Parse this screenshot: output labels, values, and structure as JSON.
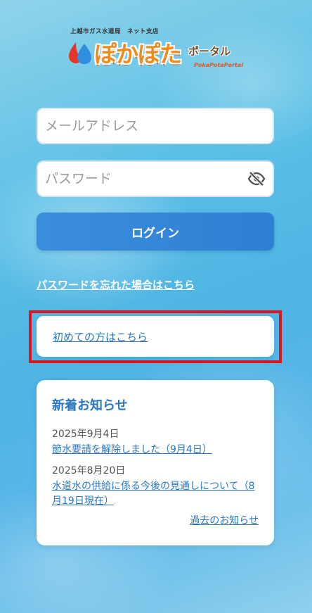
{
  "logo": {
    "top_text": "上越市ガス水道局　ネット支店",
    "main_text": "ぽかぽた",
    "sub_text": "ポータル",
    "english": "PokaPotaPortal"
  },
  "form": {
    "email_placeholder": "メールアドレス",
    "email_value": "",
    "password_placeholder": "パスワード",
    "password_value": "",
    "login_label": "ログイン"
  },
  "links": {
    "forgot_password": "パスワードを忘れた場合はこちら",
    "first_time": "初めての方はこちら"
  },
  "news": {
    "title": "新着お知らせ",
    "items": [
      {
        "date": "2025年9月4日",
        "text": "節水要請を解除しました（9月4日）"
      },
      {
        "date": "2025年8月20日",
        "text": "水道水の供給に係る今後の見通しについて（8月19日現在）"
      }
    ],
    "more_label": "過去のお知らせ"
  },
  "colors": {
    "accent": "#2f7fd4",
    "link": "#2a77c0",
    "highlight": "#d9171d"
  }
}
